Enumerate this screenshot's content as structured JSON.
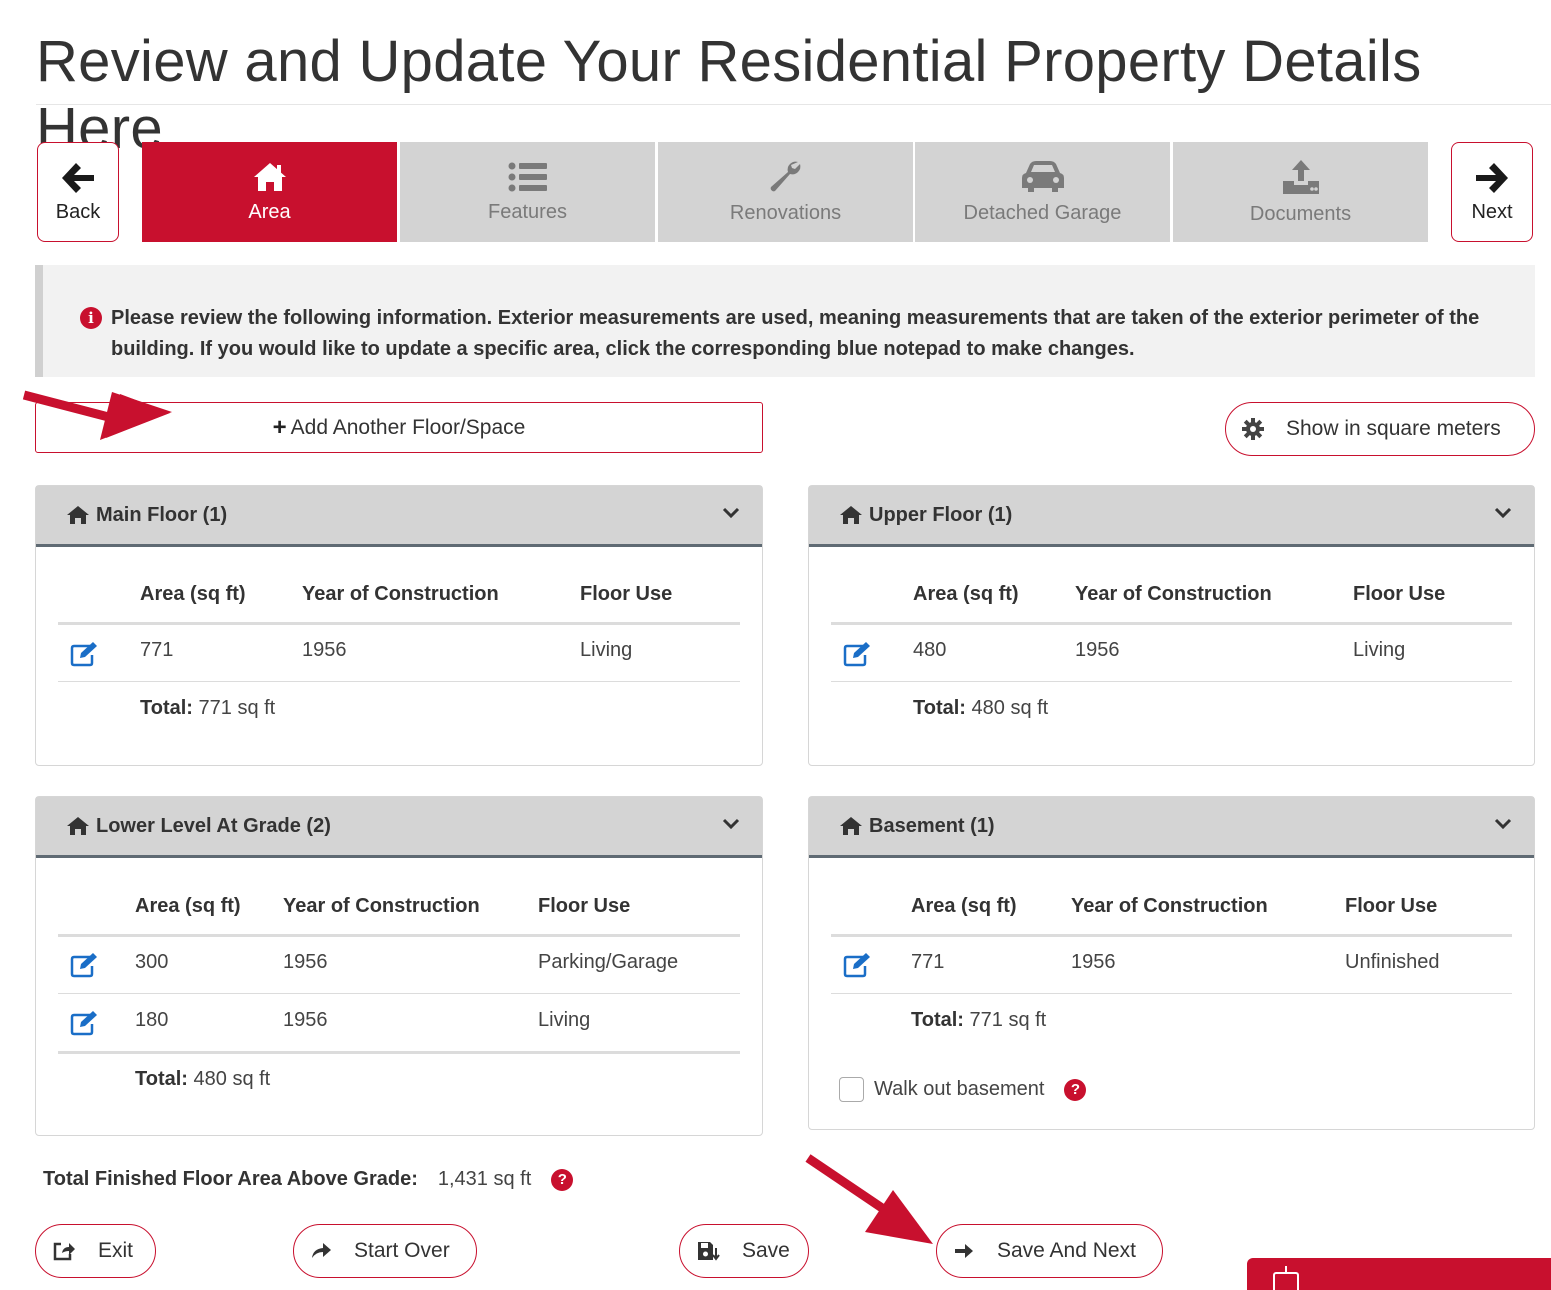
{
  "page_title": "Review and Update Your Residential Property Details Here",
  "nav": {
    "back_label": "Back",
    "next_label": "Next",
    "tabs": [
      {
        "label": "Area",
        "icon": "home-icon",
        "active": true
      },
      {
        "label": "Features",
        "icon": "list-icon",
        "active": false
      },
      {
        "label": "Renovations",
        "icon": "wrench-icon",
        "active": false
      },
      {
        "label": "Detached Garage",
        "icon": "car-icon",
        "active": false
      },
      {
        "label": "Documents",
        "icon": "upload-icon",
        "active": false
      }
    ]
  },
  "info_text": "Please review the following information. Exterior measurements are used, meaning measurements that are taken of the exterior perimeter of the building. If you would like to update a specific area, click the corresponding blue notepad to make changes.",
  "add_floor_label": "Add Another Floor/Space",
  "show_sqm_label": "Show in square meters",
  "columns": {
    "area": "Area (sq ft)",
    "year": "Year of Construction",
    "use": "Floor Use"
  },
  "total_label": "Total:",
  "panels": {
    "main": {
      "title": "Main Floor (1)",
      "rows": [
        {
          "area": "771",
          "year": "1956",
          "use": "Living"
        }
      ],
      "total": "771 sq ft"
    },
    "upper": {
      "title": "Upper Floor (1)",
      "rows": [
        {
          "area": "480",
          "year": "1956",
          "use": "Living"
        }
      ],
      "total": "480 sq ft"
    },
    "lower": {
      "title": "Lower Level At Grade (2)",
      "rows": [
        {
          "area": "300",
          "year": "1956",
          "use": "Parking/Garage"
        },
        {
          "area": "180",
          "year": "1956",
          "use": "Living"
        }
      ],
      "total": "480 sq ft"
    },
    "basement": {
      "title": "Basement (1)",
      "rows": [
        {
          "area": "771",
          "year": "1956",
          "use": "Unfinished"
        }
      ],
      "total": "771 sq ft",
      "walkout_label": "Walk out basement",
      "walkout_checked": false
    }
  },
  "total_finished": {
    "label": "Total Finished Floor Area Above Grade:",
    "value": "1,431 sq ft"
  },
  "footer": {
    "exit": "Exit",
    "start_over": "Start Over",
    "save": "Save",
    "save_next": "Save And Next"
  },
  "colors": {
    "brand": "#c8102e",
    "tab_inactive": "#d3d3d3",
    "edit_icon": "#1a6ec7"
  }
}
